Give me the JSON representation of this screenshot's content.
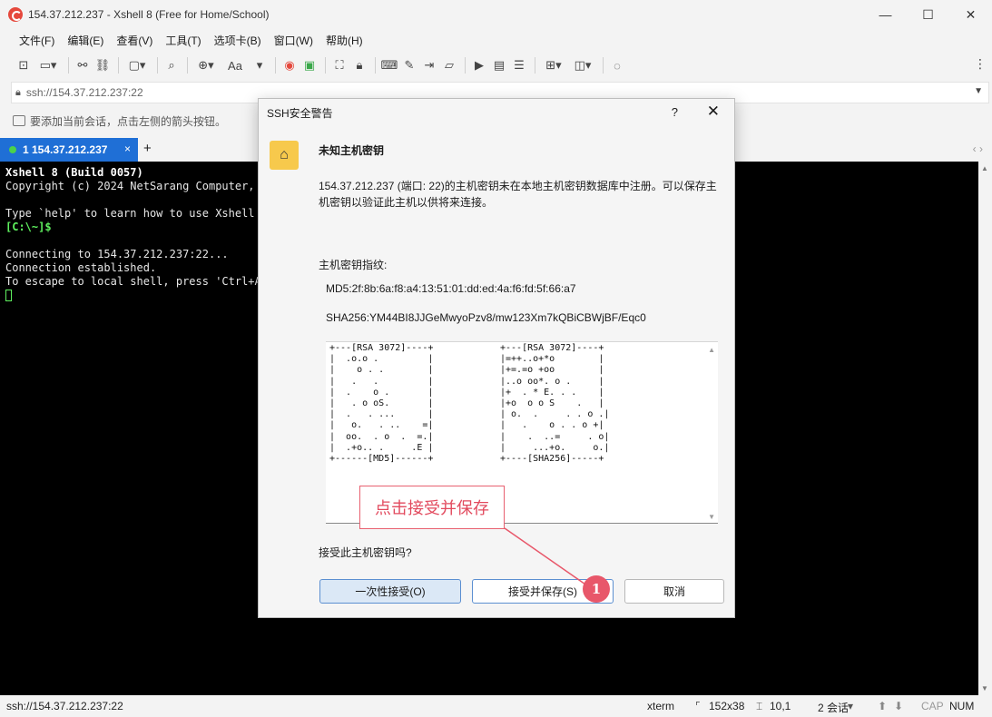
{
  "window": {
    "title": "154.37.212.237 - Xshell 8 (Free for Home/School)",
    "controls": [
      "—",
      "☐",
      "✕"
    ]
  },
  "menu": [
    "文件(F)",
    "编辑(E)",
    "查看(V)",
    "工具(T)",
    "选项卡(B)",
    "窗口(W)",
    "帮助(H)"
  ],
  "toolbar": {
    "font_label": "Aa"
  },
  "address": {
    "value": "ssh://154.37.212.237:22"
  },
  "hint": {
    "text": "要添加当前会话，点击左侧的箭头按钮。"
  },
  "tabs": {
    "active_label": "1 154.37.212.237",
    "close": "×",
    "add": "+",
    "nav": "‹  ›"
  },
  "terminal": {
    "lines": [
      "Xshell 8 (Build 0057)",
      "Copyright (c) 2024 NetSarang Computer, I",
      "",
      "Type `help' to learn how to use Xshell p",
      "[C:\\~]$",
      "",
      "Connecting to 154.37.212.237:22...",
      "Connection established.",
      "To escape to local shell, press 'Ctrl+Al"
    ]
  },
  "dialog": {
    "title": "SSH安全警告",
    "help": "?",
    "close": "✕",
    "heading": "未知主机密钥",
    "message": "154.37.212.237 (端口: 22)的主机密钥未在本地主机密钥数据库中注册。可以保存主机密钥以验证此主机以供将来连接。",
    "fingerprint_label": "主机密钥指纹:",
    "md5": "MD5:2f:8b:6a:f8:a4:13:51:01:dd:ed:4a:f6:fd:5f:66:a7",
    "sha256": "SHA256:YM44BI8JJGeMwyoPzv8/mw123Xm7kQBiCBWjBF/Eqc0",
    "art_md5": "+---[RSA 3072]----+\n|  .o.o .         |\n|    o . .        |\n|   .   .         |\n|  .    o .       |\n|   . o oS.       |\n|  .   . ...      |\n|   o.   . ..    =|\n|  oo.  . o  .  =.|\n|  .+o.. .     .E |\n+------[MD5]------+",
    "art_sha": "+---[RSA 3072]----+\n|=++..o+*o        |\n|+=.=o +oo        |\n|..o oo*. o .     |\n|+  . * E. . .    |\n|+o  o o S    .   |\n| o.  .     . . o .|\n|   .    o . . o +|\n|    .  ..=     . o|\n|     ...+o.     o.|\n+----[SHA256]-----+",
    "question": "接受此主机密钥吗?",
    "buttons": {
      "once": "一次性接受(O)",
      "save": "接受并保存(S)",
      "cancel": "取消"
    }
  },
  "annotation": {
    "text": "点击接受并保存",
    "badge": "1"
  },
  "status": {
    "address": "ssh://154.37.212.237:22",
    "term": "xterm",
    "size": "152x38",
    "pos": "10,1",
    "sessions": "2 会话",
    "cap": "CAP",
    "num": "NUM"
  }
}
